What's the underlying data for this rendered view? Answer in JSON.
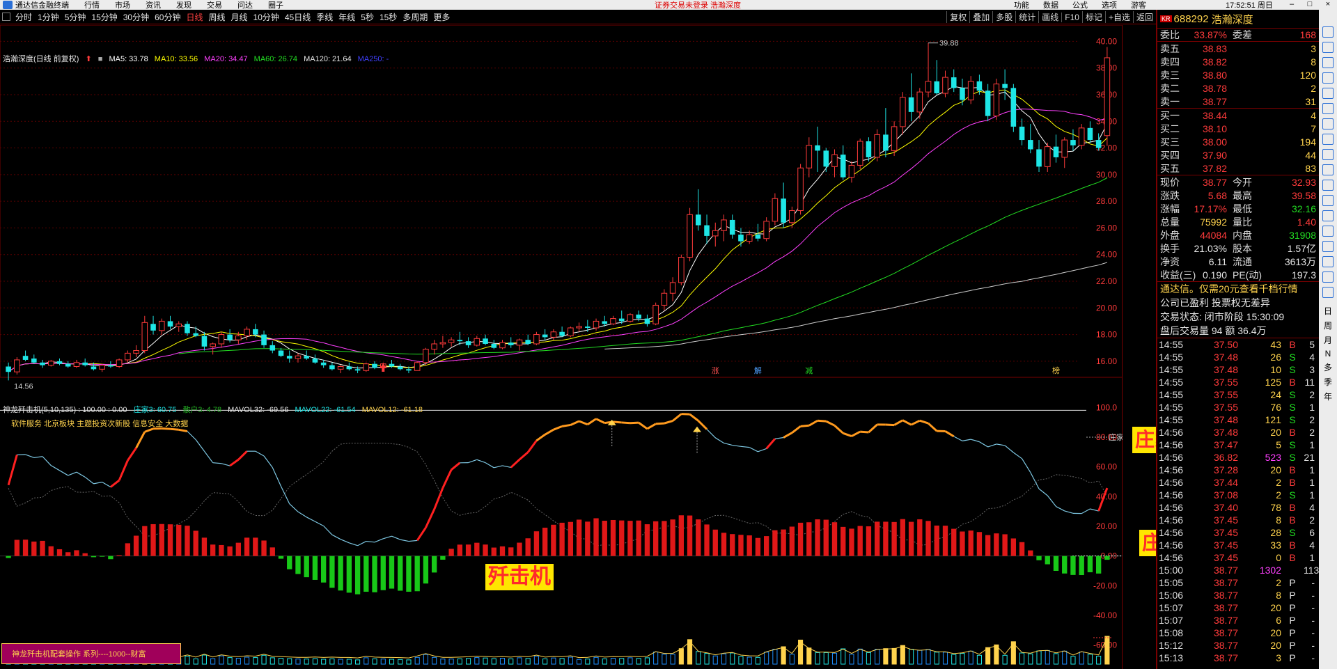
{
  "menubar": {
    "app_name": "通达信金融终端",
    "menus": [
      "行情",
      "市场",
      "资讯",
      "发现",
      "交易",
      "问达",
      "圈子"
    ],
    "notice": "证券交易未登录  浩瀚深度",
    "right_items": [
      "功能",
      "数据",
      "公式",
      "选项"
    ],
    "user": "游客",
    "clock": "17:52:51 周日"
  },
  "periods": [
    "分时",
    "1分钟",
    "5分钟",
    "15分钟",
    "30分钟",
    "60分钟",
    "日线",
    "周线",
    "月线",
    "10分钟",
    "45日线",
    "季线",
    "年线",
    "5秒",
    "15秒",
    "多周期",
    "更多"
  ],
  "active_period": "日线",
  "toolbar": [
    "复权",
    "叠加",
    "多股",
    "统计",
    "画线",
    "F10",
    "标记",
    "+自选",
    "返回"
  ],
  "kline_legend": {
    "title": "浩瀚深度(日线 前复权)",
    "ma": [
      {
        "label": "MA5: 33.78",
        "color": "#ffffff"
      },
      {
        "label": "MA10: 33.56",
        "color": "#ffff00"
      },
      {
        "label": "MA20: 34.47",
        "color": "#ff40ff"
      },
      {
        "label": "MA60: 26.74",
        "color": "#22dd22"
      },
      {
        "label": "MA120: 21.64",
        "color": "#e6e6e6"
      },
      {
        "label": "MA250: -",
        "color": "#4040ff"
      }
    ]
  },
  "indicator_legend": {
    "name": "神龙歼击机(5,10,135) : 100.00 : 0.00",
    "items": [
      {
        "label": "庄家3: 60.75",
        "color": "#1ee6e6"
      },
      {
        "label": "散户3: 4.78",
        "color": "#22aa22"
      },
      {
        "label": "MAVOL32: -69.56",
        "color": "#e6e6e6"
      },
      {
        "label": "MAVOL22: -61.54",
        "color": "#1ee6e6"
      },
      {
        "label": "MAVOL12: -61.18",
        "color": "#ffd34d"
      }
    ]
  },
  "sectors": "软件服务 北京板块 主题投资次新股 信息安全 大数据",
  "price_axis": [
    "40.00",
    "38.00",
    "36.00",
    "34.00",
    "32.00",
    "30.00",
    "28.00",
    "26.00",
    "24.00",
    "22.00",
    "20.00",
    "18.00",
    "16.00"
  ],
  "ind_axis": [
    "100.0",
    "80.00",
    "60.00",
    "40.00",
    "20.00",
    "0.00",
    "-20.00",
    "-40.00",
    "-60.00"
  ],
  "price_high_label": "39.88",
  "price_low_label": "14.56",
  "event_marks": [
    {
      "text": "涨",
      "color": "#ff5050"
    },
    {
      "text": "解",
      "color": "#4fa0ff"
    },
    {
      "text": "减",
      "color": "#22dd22"
    },
    {
      "text": "榜",
      "color": "#ffd34d"
    }
  ],
  "zhuang_tag": "庄家",
  "labels": {
    "zhuangjia_line": "庄家线",
    "zhuangjia_energy": "庄家能量",
    "jianjiji": "歼击机",
    "promo": "神龙歼击机配套操作 系列----1000--财富"
  },
  "stock": {
    "badge": "KR",
    "code": "688292",
    "name": "浩瀚深度"
  },
  "order_ratio": {
    "label1": "委比",
    "val1": "33.87%",
    "label2": "委差",
    "val2": "168"
  },
  "asks": [
    {
      "label": "卖五",
      "price": "38.83",
      "vol": "3"
    },
    {
      "label": "卖四",
      "price": "38.82",
      "vol": "8"
    },
    {
      "label": "卖三",
      "price": "38.80",
      "vol": "120"
    },
    {
      "label": "卖二",
      "price": "38.78",
      "vol": "2"
    },
    {
      "label": "卖一",
      "price": "38.77",
      "vol": "31"
    }
  ],
  "bids": [
    {
      "label": "买一",
      "price": "38.44",
      "vol": "4"
    },
    {
      "label": "买二",
      "price": "38.10",
      "vol": "7"
    },
    {
      "label": "买三",
      "price": "38.00",
      "vol": "194"
    },
    {
      "label": "买四",
      "price": "37.90",
      "vol": "44"
    },
    {
      "label": "买五",
      "price": "37.82",
      "vol": "83"
    }
  ],
  "stats": [
    {
      "l1": "现价",
      "v1": "38.77",
      "c1": "red",
      "l2": "今开",
      "v2": "32.93",
      "c2": "red"
    },
    {
      "l1": "涨跌",
      "v1": "5.68",
      "c1": "red",
      "l2": "最高",
      "v2": "39.58",
      "c2": "red"
    },
    {
      "l1": "涨幅",
      "v1": "17.17%",
      "c1": "red",
      "l2": "最低",
      "v2": "32.16",
      "c2": "grn"
    },
    {
      "l1": "总量",
      "v1": "75992",
      "c1": "yel",
      "l2": "量比",
      "v2": "1.40",
      "c2": "red"
    },
    {
      "l1": "外盘",
      "v1": "44084",
      "c1": "red",
      "l2": "内盘",
      "v2": "31908",
      "c2": "grn"
    },
    {
      "l1": "换手",
      "v1": "21.03%",
      "c1": "wht",
      "l2": "股本",
      "v2": "1.57亿",
      "c2": "wht"
    },
    {
      "l1": "净资",
      "v1": "6.11",
      "c1": "wht",
      "l2": "流通",
      "v2": "3613万",
      "c2": "wht"
    },
    {
      "l1": "收益(三)",
      "v1": "0.190",
      "c1": "wht",
      "l2": "PE(动)",
      "v2": "197.3",
      "c2": "wht"
    }
  ],
  "info_lines": [
    {
      "text": "通达信。仅需20元查看千档行情",
      "color": "yel"
    },
    {
      "text": "公司已盈利 投票权无差异",
      "color": "wht"
    },
    {
      "text": "交易状态: 闭市阶段 15:30:09",
      "color": "wht"
    },
    {
      "text": "盘后交易量 94 额 36.4万",
      "color": "wht"
    }
  ],
  "ticks": [
    {
      "t": "14:55",
      "p": "37.50",
      "q": "43",
      "s": "B",
      "n": "5"
    },
    {
      "t": "14:55",
      "p": "37.48",
      "q": "26",
      "s": "S",
      "n": "4"
    },
    {
      "t": "14:55",
      "p": "37.48",
      "q": "10",
      "s": "S",
      "n": "3"
    },
    {
      "t": "14:55",
      "p": "37.55",
      "q": "125",
      "s": "B",
      "n": "11"
    },
    {
      "t": "14:55",
      "p": "37.55",
      "q": "24",
      "s": "S",
      "n": "2"
    },
    {
      "t": "14:55",
      "p": "37.55",
      "q": "76",
      "s": "S",
      "n": "1"
    },
    {
      "t": "14:55",
      "p": "37.48",
      "q": "121",
      "s": "S",
      "n": "2"
    },
    {
      "t": "14:56",
      "p": "37.48",
      "q": "20",
      "s": "B",
      "n": "2"
    },
    {
      "t": "14:56",
      "p": "37.47",
      "q": "5",
      "s": "S",
      "n": "1"
    },
    {
      "t": "14:56",
      "p": "36.82",
      "q": "523",
      "s": "S",
      "n": "21"
    },
    {
      "t": "14:56",
      "p": "37.28",
      "q": "20",
      "s": "B",
      "n": "1"
    },
    {
      "t": "14:56",
      "p": "37.44",
      "q": "2",
      "s": "B",
      "n": "1"
    },
    {
      "t": "14:56",
      "p": "37.08",
      "q": "2",
      "s": "S",
      "n": "1"
    },
    {
      "t": "14:56",
      "p": "37.40",
      "q": "78",
      "s": "B",
      "n": "4"
    },
    {
      "t": "14:56",
      "p": "37.45",
      "q": "8",
      "s": "B",
      "n": "2"
    },
    {
      "t": "14:56",
      "p": "37.45",
      "q": "28",
      "s": "S",
      "n": "6"
    },
    {
      "t": "14:56",
      "p": "37.45",
      "q": "33",
      "s": "B",
      "n": "4"
    },
    {
      "t": "14:56",
      "p": "37.45",
      "q": "0",
      "s": "B",
      "n": "1"
    },
    {
      "t": "15:00",
      "p": "38.77",
      "q": "1302",
      "s": "",
      "n": "113"
    },
    {
      "t": "15:05",
      "p": "38.77",
      "q": "2",
      "s": "P",
      "n": "-"
    },
    {
      "t": "15:06",
      "p": "38.77",
      "q": "8",
      "s": "P",
      "n": "-"
    },
    {
      "t": "15:07",
      "p": "38.77",
      "q": "20",
      "s": "P",
      "n": "-"
    },
    {
      "t": "15:07",
      "p": "38.77",
      "q": "6",
      "s": "P",
      "n": "-"
    },
    {
      "t": "15:08",
      "p": "38.77",
      "q": "20",
      "s": "P",
      "n": "-"
    },
    {
      "t": "15:12",
      "p": "38.77",
      "q": "20",
      "s": "P",
      "n": "-"
    },
    {
      "t": "15:13",
      "p": "38.77",
      "q": "3",
      "s": "P",
      "n": "-"
    }
  ],
  "sidebar_chars": [
    "日",
    "周",
    "月",
    "N",
    "多",
    "季",
    "年"
  ],
  "chart_data": {
    "type": "candlestick",
    "price_range": [
      15,
      40.7
    ],
    "candles": [
      [
        15.6,
        15.9,
        14.56,
        15.2
      ],
      [
        15.2,
        16.3,
        15.0,
        16.1
      ],
      [
        16.4,
        16.8,
        16.0,
        16.1
      ],
      [
        16.2,
        16.5,
        15.8,
        15.9
      ],
      [
        15.9,
        16.1,
        15.5,
        15.7
      ],
      [
        15.7,
        16.1,
        15.6,
        16.0
      ],
      [
        16.0,
        16.2,
        15.7,
        15.8
      ],
      [
        15.8,
        16.0,
        15.5,
        15.6
      ],
      [
        15.6,
        16.1,
        15.5,
        15.9
      ],
      [
        15.9,
        16.2,
        15.6,
        15.7
      ],
      [
        15.6,
        15.9,
        15.3,
        15.4
      ],
      [
        15.4,
        15.8,
        15.2,
        15.7
      ],
      [
        15.7,
        16.0,
        15.5,
        15.6
      ],
      [
        15.6,
        16.2,
        15.5,
        16.1
      ],
      [
        16.1,
        16.8,
        15.9,
        16.6
      ],
      [
        16.6,
        17.2,
        16.3,
        16.8
      ],
      [
        16.8,
        19.4,
        16.6,
        18.9
      ],
      [
        18.8,
        19.4,
        18.0,
        18.3
      ],
      [
        18.3,
        19.2,
        18.0,
        19.0
      ],
      [
        19.0,
        19.4,
        18.4,
        18.6
      ],
      [
        18.6,
        19.0,
        18.2,
        18.8
      ],
      [
        18.8,
        19.0,
        17.9,
        18.1
      ],
      [
        18.1,
        18.6,
        17.8,
        17.9
      ],
      [
        17.9,
        18.2,
        16.8,
        17.1
      ],
      [
        17.1,
        17.4,
        16.5,
        17.3
      ],
      [
        17.3,
        18.2,
        17.0,
        18.0
      ],
      [
        18.0,
        18.4,
        17.4,
        17.6
      ],
      [
        17.6,
        18.2,
        17.3,
        17.9
      ],
      [
        17.9,
        18.6,
        17.6,
        18.4
      ],
      [
        18.4,
        18.8,
        17.8,
        18.0
      ],
      [
        18.0,
        18.3,
        17.0,
        17.2
      ],
      [
        17.2,
        17.5,
        16.6,
        16.8
      ],
      [
        16.8,
        17.0,
        16.3,
        16.4
      ],
      [
        16.4,
        16.8,
        15.9,
        16.2
      ],
      [
        16.2,
        16.6,
        15.9,
        16.4
      ],
      [
        16.4,
        16.8,
        16.1,
        16.2
      ],
      [
        16.2,
        16.5,
        15.8,
        15.9
      ],
      [
        15.9,
        16.1,
        15.5,
        15.7
      ],
      [
        15.7,
        15.9,
        15.3,
        15.4
      ],
      [
        15.4,
        15.7,
        15.1,
        15.6
      ],
      [
        15.6,
        15.9,
        15.3,
        15.4
      ],
      [
        15.4,
        15.6,
        15.1,
        15.3
      ],
      [
        15.3,
        15.9,
        15.2,
        15.8
      ],
      [
        15.8,
        16.0,
        15.4,
        15.5
      ],
      [
        15.5,
        15.9,
        15.4,
        15.8
      ],
      [
        15.8,
        16.1,
        15.5,
        15.6
      ],
      [
        15.6,
        15.8,
        15.3,
        15.4
      ],
      [
        15.4,
        15.6,
        15.1,
        15.3
      ],
      [
        15.3,
        16.0,
        15.3,
        15.9
      ],
      [
        15.9,
        17.0,
        15.7,
        16.9
      ],
      [
        16.9,
        17.6,
        16.5,
        17.3
      ],
      [
        17.3,
        17.9,
        17.0,
        17.4
      ],
      [
        17.4,
        17.8,
        17.1,
        17.6
      ],
      [
        17.6,
        18.2,
        17.2,
        17.5
      ],
      [
        17.5,
        17.8,
        17.0,
        17.2
      ],
      [
        17.2,
        17.9,
        17.1,
        17.7
      ],
      [
        17.7,
        18.0,
        17.2,
        17.3
      ],
      [
        17.3,
        17.6,
        16.9,
        17.0
      ],
      [
        17.0,
        17.6,
        16.9,
        17.4
      ],
      [
        17.4,
        17.8,
        17.0,
        17.2
      ],
      [
        17.2,
        17.7,
        16.8,
        17.6
      ],
      [
        17.6,
        18.0,
        17.2,
        17.3
      ],
      [
        17.3,
        18.2,
        17.2,
        18.0
      ],
      [
        18.0,
        18.4,
        17.6,
        17.8
      ],
      [
        17.8,
        18.4,
        17.6,
        18.2
      ],
      [
        18.2,
        18.6,
        17.8,
        17.9
      ],
      [
        17.9,
        18.6,
        17.8,
        18.5
      ],
      [
        18.5,
        18.9,
        18.2,
        18.6
      ],
      [
        18.6,
        19.1,
        18.2,
        18.5
      ],
      [
        18.5,
        19.2,
        18.3,
        19.0
      ],
      [
        19.0,
        19.4,
        18.6,
        18.8
      ],
      [
        18.8,
        19.4,
        18.7,
        19.2
      ],
      [
        19.2,
        19.8,
        18.8,
        19.0
      ],
      [
        19.0,
        19.6,
        18.9,
        19.5
      ],
      [
        19.5,
        19.8,
        19.0,
        19.2
      ],
      [
        19.2,
        19.5,
        18.6,
        18.8
      ],
      [
        18.8,
        20.4,
        18.7,
        20.2
      ],
      [
        20.2,
        21.4,
        19.8,
        21.1
      ],
      [
        21.1,
        22.3,
        20.5,
        21.9
      ],
      [
        21.9,
        24.0,
        21.7,
        23.8
      ],
      [
        23.8,
        27.5,
        23.5,
        27.0
      ],
      [
        27.0,
        28.9,
        25.8,
        26.2
      ],
      [
        26.2,
        27.0,
        24.8,
        25.4
      ],
      [
        25.4,
        26.4,
        24.6,
        25.8
      ],
      [
        25.8,
        27.0,
        25.0,
        26.6
      ],
      [
        26.6,
        27.0,
        25.2,
        25.5
      ],
      [
        25.5,
        26.0,
        24.6,
        25.0
      ],
      [
        25.0,
        25.8,
        24.8,
        25.5
      ],
      [
        25.5,
        26.3,
        25.0,
        25.2
      ],
      [
        25.2,
        26.8,
        25.0,
        26.5
      ],
      [
        26.5,
        28.6,
        26.2,
        28.2
      ],
      [
        28.2,
        29.4,
        26.0,
        26.4
      ],
      [
        26.4,
        27.6,
        26.0,
        27.3
      ],
      [
        27.3,
        30.8,
        27.0,
        30.5
      ],
      [
        30.5,
        32.8,
        29.8,
        32.2
      ],
      [
        32.2,
        33.6,
        30.2,
        31.8
      ],
      [
        31.8,
        32.0,
        30.2,
        30.6
      ],
      [
        30.6,
        31.9,
        29.8,
        31.5
      ],
      [
        31.5,
        32.2,
        29.6,
        29.8
      ],
      [
        29.8,
        31.0,
        29.4,
        30.7
      ],
      [
        30.7,
        32.7,
        30.4,
        32.5
      ],
      [
        32.5,
        32.8,
        31.0,
        31.3
      ],
      [
        31.3,
        33.4,
        31.0,
        33.0
      ],
      [
        33.0,
        35.0,
        31.3,
        31.8
      ],
      [
        31.8,
        34.0,
        31.4,
        33.6
      ],
      [
        33.6,
        36.2,
        33.0,
        35.8
      ],
      [
        35.8,
        37.6,
        34.0,
        34.7
      ],
      [
        34.7,
        36.5,
        34.2,
        36.2
      ],
      [
        36.2,
        39.88,
        35.8,
        37.0
      ],
      [
        37.0,
        38.6,
        36.0,
        36.1
      ],
      [
        36.1,
        37.8,
        35.8,
        37.3
      ],
      [
        37.3,
        37.9,
        36.2,
        36.5
      ],
      [
        36.5,
        37.2,
        35.2,
        35.6
      ],
      [
        35.6,
        37.4,
        35.3,
        37.0
      ],
      [
        37.0,
        37.5,
        36.0,
        36.3
      ],
      [
        36.3,
        36.8,
        34.0,
        34.4
      ],
      [
        34.4,
        37.2,
        34.1,
        36.8
      ],
      [
        36.8,
        37.9,
        35.6,
        36.5
      ],
      [
        36.5,
        36.8,
        33.2,
        33.6
      ],
      [
        33.6,
        34.2,
        32.2,
        32.6
      ],
      [
        32.6,
        33.8,
        31.6,
        31.9
      ],
      [
        31.9,
        32.6,
        30.2,
        30.6
      ],
      [
        30.6,
        32.4,
        30.2,
        32.1
      ],
      [
        32.1,
        33.0,
        30.9,
        31.3
      ],
      [
        31.3,
        32.8,
        30.5,
        32.6
      ],
      [
        32.6,
        33.4,
        31.8,
        32.2
      ],
      [
        32.2,
        33.8,
        31.9,
        33.5
      ],
      [
        33.5,
        34.0,
        32.4,
        32.6
      ],
      [
        32.6,
        33.1,
        31.8,
        32.0
      ],
      [
        32.93,
        39.58,
        32.16,
        38.77
      ]
    ]
  }
}
